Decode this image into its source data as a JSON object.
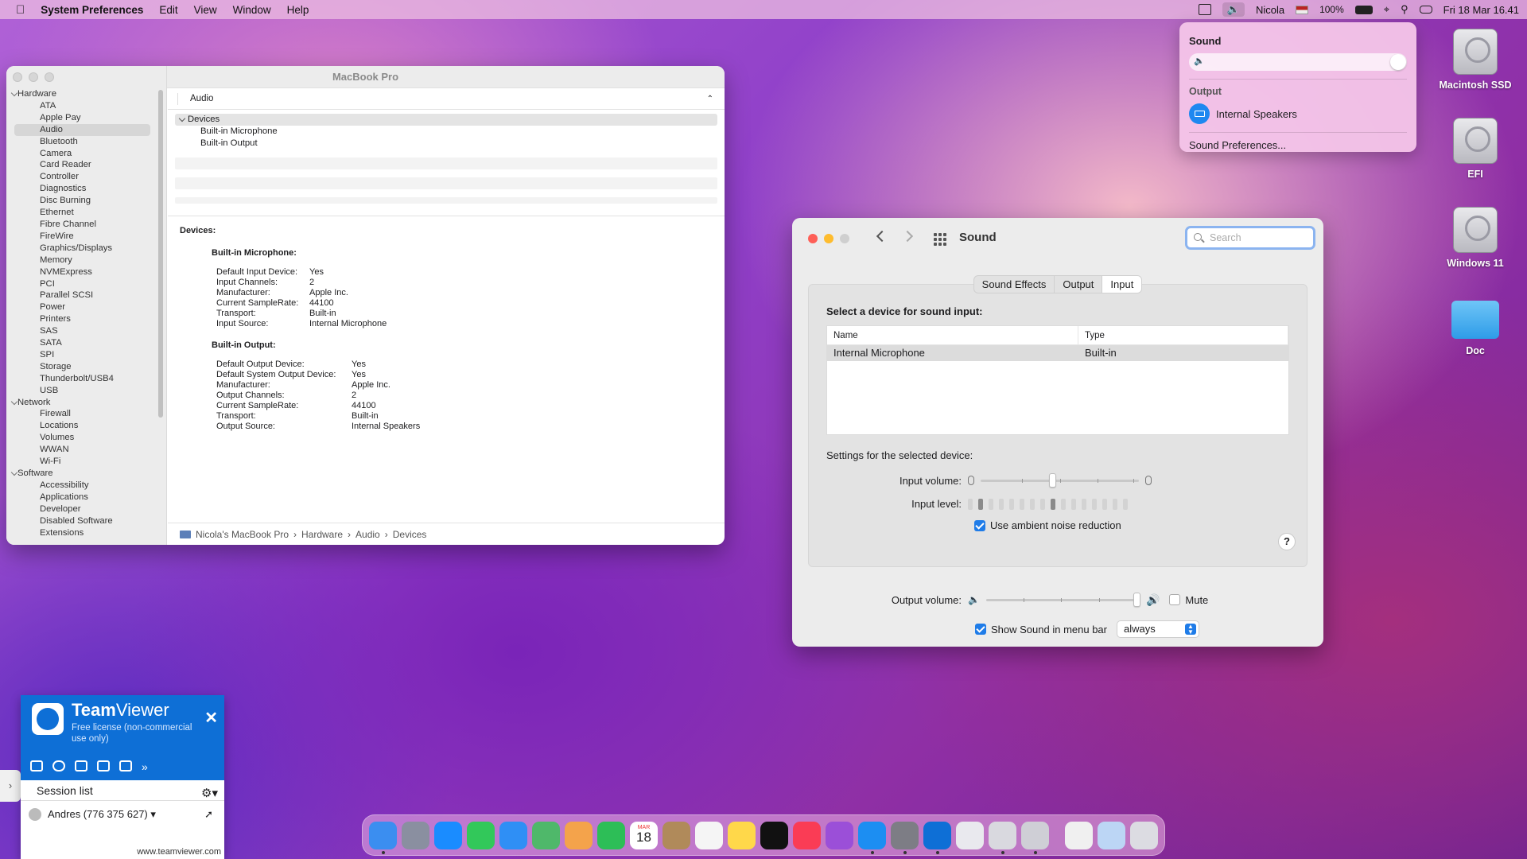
{
  "menubar": {
    "app_name": "System Preferences",
    "menus": [
      "Edit",
      "View",
      "Window",
      "Help"
    ],
    "user": "Nicola",
    "battery": "100%",
    "datetime": "Fri 18 Mar  16.41"
  },
  "sound_menu": {
    "title": "Sound",
    "output_heading": "Output",
    "output_device": "Internal Speakers",
    "preferences_link": "Sound Preferences...",
    "volume_level": 1.0
  },
  "desktop_icons": [
    "Macintosh SSD",
    "EFI",
    "Windows 11",
    "Doc"
  ],
  "system_info": {
    "window_title": "MacBook Pro",
    "sidebar": {
      "hardware_label": "Hardware",
      "hardware": [
        "ATA",
        "Apple Pay",
        "Audio",
        "Bluetooth",
        "Camera",
        "Card Reader",
        "Controller",
        "Diagnostics",
        "Disc Burning",
        "Ethernet",
        "Fibre Channel",
        "FireWire",
        "Graphics/Displays",
        "Memory",
        "NVMExpress",
        "PCI",
        "Parallel SCSI",
        "Power",
        "Printers",
        "SAS",
        "SATA",
        "SPI",
        "Storage",
        "Thunderbolt/USB4",
        "USB"
      ],
      "network_label": "Network",
      "network": [
        "Firewall",
        "Locations",
        "Volumes",
        "WWAN",
        "Wi-Fi"
      ],
      "software_label": "Software",
      "software": [
        "Accessibility",
        "Applications",
        "Developer",
        "Disabled Software",
        "Extensions"
      ],
      "selected": "Audio"
    },
    "section_header": "Audio",
    "tree": {
      "group": "Devices",
      "items": [
        "Built-in Microphone",
        "Built-in Output"
      ]
    },
    "details": {
      "heading": "Devices:",
      "mic_title": "Built-in Microphone:",
      "mic": [
        [
          "Default Input Device:",
          "Yes"
        ],
        [
          "Input Channels:",
          "2"
        ],
        [
          "Manufacturer:",
          "Apple Inc."
        ],
        [
          "Current SampleRate:",
          "44100"
        ],
        [
          "Transport:",
          "Built-in"
        ],
        [
          "Input Source:",
          "Internal Microphone"
        ]
      ],
      "out_title": "Built-in Output:",
      "out": [
        [
          "Default Output Device:",
          "Yes"
        ],
        [
          "Default System Output Device:",
          "Yes"
        ],
        [
          "Manufacturer:",
          "Apple Inc."
        ],
        [
          "Output Channels:",
          "2"
        ],
        [
          "Current SampleRate:",
          "44100"
        ],
        [
          "Transport:",
          "Built-in"
        ],
        [
          "Output Source:",
          "Internal Speakers"
        ]
      ]
    },
    "breadcrumb": [
      "Nicola's MacBook Pro",
      "Hardware",
      "Audio",
      "Devices"
    ]
  },
  "sound_prefs": {
    "title": "Sound",
    "search_placeholder": "Search",
    "tabs": [
      "Sound Effects",
      "Output",
      "Input"
    ],
    "active_tab": "Input",
    "select_label": "Select a device for sound input:",
    "columns": [
      "Name",
      "Type"
    ],
    "devices": [
      [
        "Internal Microphone",
        "Built-in"
      ]
    ],
    "settings_label": "Settings for the selected device:",
    "input_volume_label": "Input volume:",
    "input_volume": 0.45,
    "input_level_label": "Input level:",
    "input_level_on": [
      1,
      8
    ],
    "ambient_label": "Use ambient noise reduction",
    "ambient_checked": true,
    "help": "?",
    "output_volume_label": "Output volume:",
    "output_volume": 1.0,
    "mute_label": "Mute",
    "mute_checked": false,
    "show_sound_label": "Show Sound in menu bar",
    "show_sound_checked": true,
    "show_sound_option": "always"
  },
  "teamviewer": {
    "brand_bold": "Team",
    "brand_light": "Viewer",
    "subtitle": "Free license (non-commercial use only)",
    "session_list": "Session list",
    "contact": "Andres (776 375 627)",
    "url": "www.teamviewer.com"
  },
  "dock_apps": [
    "Finder",
    "Launchpad",
    "Safari",
    "Messages",
    "Mail",
    "Maps",
    "Photos",
    "FaceTime",
    "Calendar",
    "Contacts",
    "Reminders",
    "Notes",
    "TV",
    "Music",
    "Podcasts",
    "App Store",
    "System Preferences",
    "TeamViewer",
    "Preview",
    "Script Editor",
    "Printer",
    "Document",
    "Downloads",
    "Trash"
  ],
  "calendar": {
    "month": "MAR",
    "day": "18"
  },
  "colors": {
    "accent": "#1f7ce8",
    "teamviewer": "#0e6fd6"
  }
}
